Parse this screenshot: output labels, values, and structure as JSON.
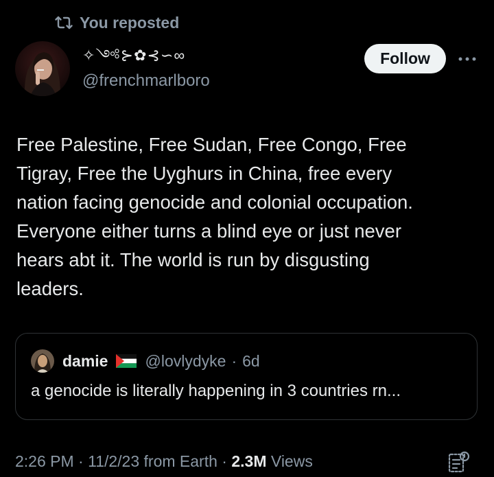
{
  "repost": {
    "icon": "repost-icon",
    "label": "You reposted"
  },
  "author": {
    "display_name": "✧༺⊱✿⊰∽∞",
    "handle": "@frenchmarlboro",
    "avatar": "avatar"
  },
  "actions": {
    "follow_label": "Follow",
    "more_icon": "more-icon"
  },
  "tweet": {
    "lines": [
      "Free Palestine, Free Sudan, Free Congo, Free",
      "Tigray, Free the Uyghurs in China, free every",
      "nation facing genocide and colonial occupation.",
      "Everyone either turns a blind eye or just never",
      "hears abt it. The world is run by disgusting",
      "leaders."
    ]
  },
  "quote": {
    "name": "damie",
    "flag": "palestine-flag",
    "handle": "@lovlydyke",
    "separator": "·",
    "time": "6d",
    "text": "a genocide is literally happening in 3 countries rn..."
  },
  "meta": {
    "time": "2:26 PM",
    "sep1": " · ",
    "date": "11/2/23",
    "source": " from Earth",
    "sep2": " · ",
    "views_count": "2.3M",
    "views_label": " Views",
    "analytics_icon": "analytics-icon"
  },
  "colors": {
    "background": "#000000",
    "text": "#e7e9ea",
    "secondary": "#8b98a5",
    "border": "#2f3336",
    "follow_bg": "#eff3f4"
  }
}
